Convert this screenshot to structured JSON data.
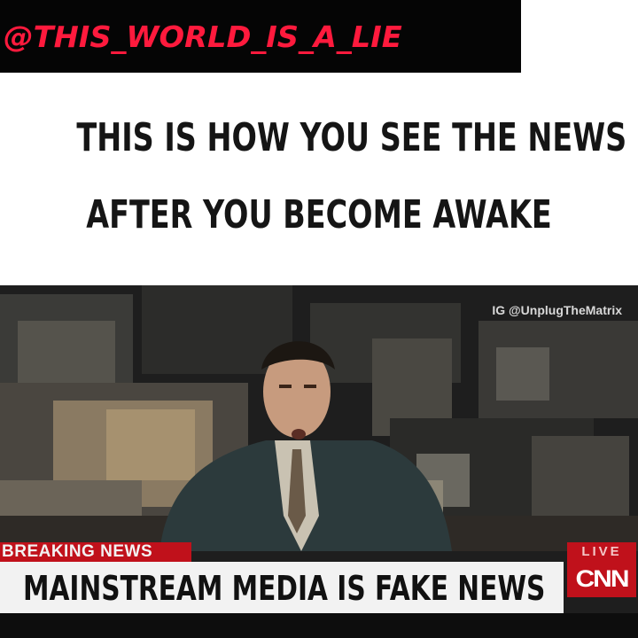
{
  "watermark": {
    "handle": "@THIS_WORLD_IS_A_LIE",
    "color": "#ff1a3d"
  },
  "caption": {
    "line1": "THIS IS HOW YOU SEE THE NEWS",
    "line2": "AFTER YOU BECOME AWAKE"
  },
  "video": {
    "credit": "IG @UnplugTheMatrix",
    "chyron": {
      "label": "BREAKING NEWS",
      "headline": "MAINSTREAM MEDIA IS FAKE NEWS",
      "live": "LIVE",
      "network": "CNN",
      "accent": "#c0111b"
    }
  }
}
